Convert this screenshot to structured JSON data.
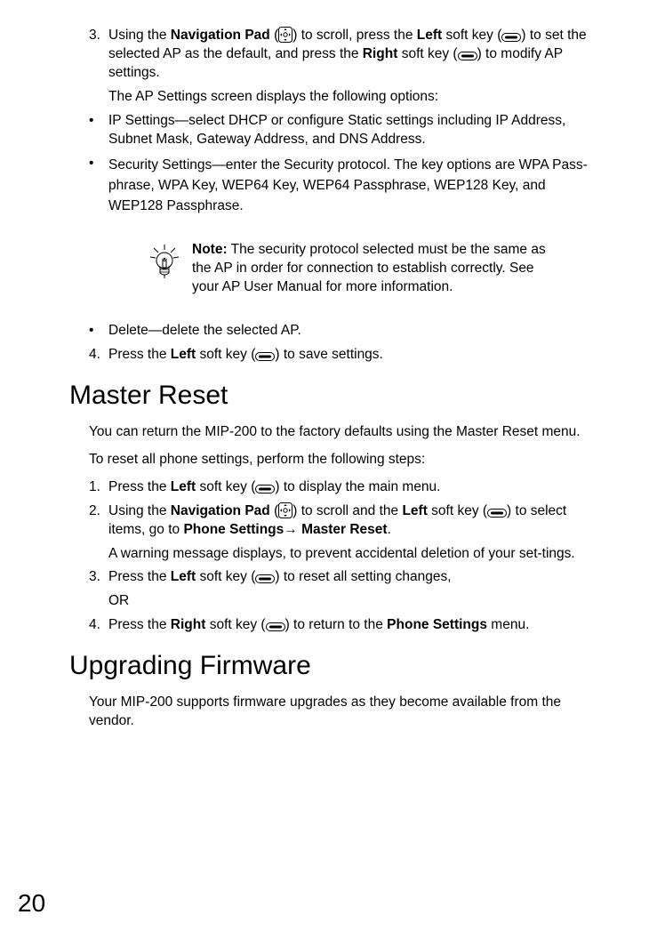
{
  "step3": {
    "num": "3.",
    "pre1": "Using the ",
    "bold1": "Navigation Pad",
    "post1": " (",
    "post2": ") to scroll, press the ",
    "bold2": "Left",
    "post3": " soft key (",
    "post4": ") to set the selected AP as the default, and press the ",
    "bold3": "Right",
    "post5": " soft key (",
    "post6": ") to modify AP settings.",
    "follow": "The AP Settings screen displays the following options:"
  },
  "bullet_ip": {
    "bul": "•",
    "text": "IP Settings—select DHCP or configure Static settings including IP Address, Subnet Mask, Gateway Address, and DNS Address."
  },
  "bullet_sec": {
    "bul": "•",
    "text": "Security Settings—enter the Security protocol. The key options are WPA Pass-phrase, WPA Key, WEP64 Key, WEP64 Passphrase, WEP128 Key, and WEP128 Passphrase."
  },
  "note": {
    "bold": "Note:",
    "text": " The security protocol selected must be the same as the AP in order for connection to establish correctly. See your AP User Manual for more information."
  },
  "bullet_del": {
    "bul": "•",
    "text": "Delete—delete the selected AP."
  },
  "step4": {
    "num": "4.",
    "pre1": "Press the ",
    "bold1": "Left",
    "post1": " soft key (",
    "post2": ") to save settings."
  },
  "heading_master": "Master Reset",
  "master_intro": "You can return the MIP-200 to the factory defaults using the Master Reset menu.",
  "master_lead": "To reset all phone settings, perform the following steps:",
  "m1": {
    "num": "1.",
    "pre1": "Press the ",
    "bold1": "Left",
    "post1": " soft key (",
    "post2": ") to display the main menu."
  },
  "m2": {
    "num": "2.",
    "pre1": "Using the ",
    "bold1": "Navigation Pad",
    "post1": " (",
    "post2": ") to scroll and the ",
    "bold2": "Left",
    "post3": " soft key (",
    "post4": ") to select items, go to ",
    "bold3": "Phone Settings",
    "arrow": "→ ",
    "bold4": "Master Reset",
    "post5": ".",
    "follow": "A warning message displays, to prevent accidental deletion of your set-tings."
  },
  "m3": {
    "num": "3.",
    "pre1": "Press the ",
    "bold1": "Left",
    "post1": " soft key (",
    "post2": ") to reset all setting changes,",
    "or": "OR"
  },
  "m4": {
    "num": "4.",
    "pre1": "Press the ",
    "bold1": "Right",
    "post1": " soft key (",
    "post2": ") to return to the ",
    "bold2": "Phone Settings",
    "post3": " menu."
  },
  "heading_upgrade": "Upgrading Firmware",
  "upgrade_intro": "Your MIP-200 supports firmware upgrades as they become available from the vendor.",
  "pagenum": "20"
}
